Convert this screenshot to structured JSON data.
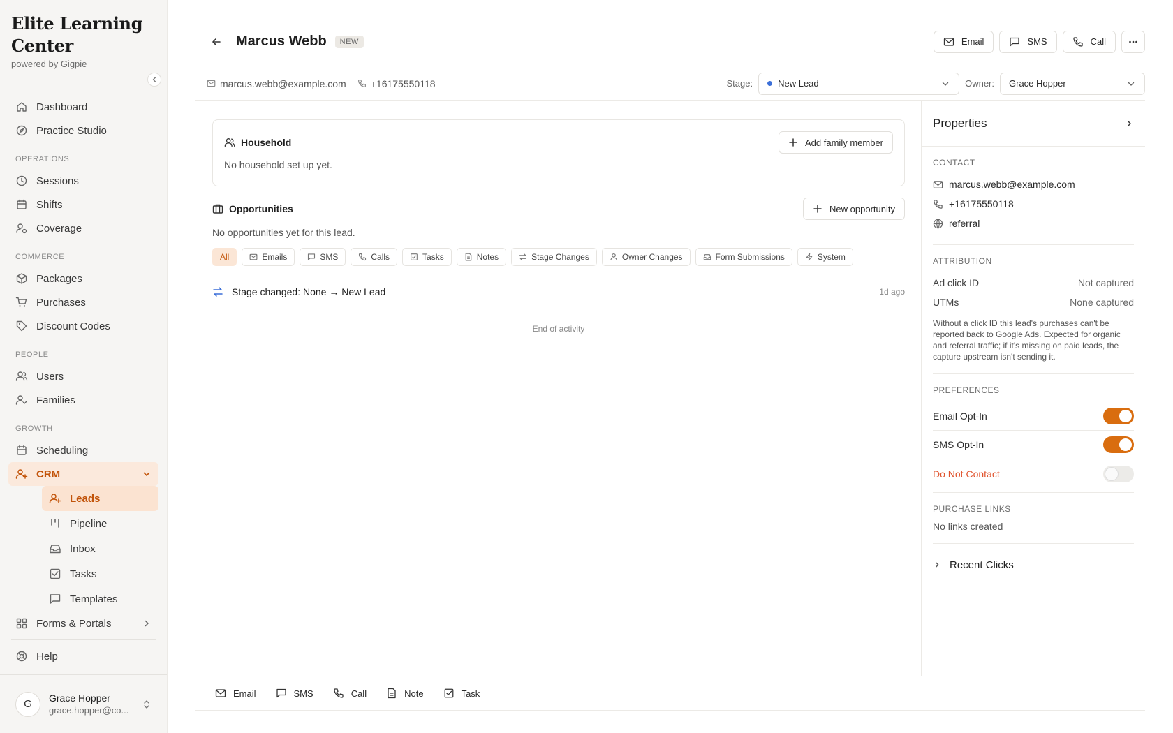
{
  "brand": {
    "title": "Elite Learning Center",
    "subtitle": "powered by Gigpie"
  },
  "nav": {
    "dashboard": "Dashboard",
    "practice_studio": "Practice Studio",
    "section_operations": "OPERATIONS",
    "sessions": "Sessions",
    "shifts": "Shifts",
    "coverage": "Coverage",
    "section_commerce": "COMMERCE",
    "packages": "Packages",
    "purchases": "Purchases",
    "discount_codes": "Discount Codes",
    "section_people": "PEOPLE",
    "users": "Users",
    "families": "Families",
    "section_growth": "GROWTH",
    "scheduling": "Scheduling",
    "crm": "CRM",
    "leads": "Leads",
    "pipeline": "Pipeline",
    "inbox": "Inbox",
    "tasks": "Tasks",
    "templates": "Templates",
    "forms_portals": "Forms & Portals",
    "help": "Help"
  },
  "user": {
    "initial": "G",
    "name": "Grace Hopper",
    "email": "grace.hopper@co..."
  },
  "lead": {
    "name": "Marcus Webb",
    "badge": "NEW",
    "email": "marcus.webb@example.com",
    "phone": "+16175550118"
  },
  "top_actions": {
    "email": "Email",
    "sms": "SMS",
    "call": "Call"
  },
  "stage": {
    "label": "Stage:",
    "value": "New Lead",
    "color": "#3b6fd8"
  },
  "owner": {
    "label": "Owner:",
    "value": "Grace Hopper"
  },
  "household": {
    "title": "Household",
    "add_button": "Add family member",
    "empty": "No household set up yet."
  },
  "opportunities": {
    "title": "Opportunities",
    "new_button": "New opportunity",
    "empty": "No opportunities yet for this lead."
  },
  "filters": [
    "All",
    "Emails",
    "SMS",
    "Calls",
    "Tasks",
    "Notes",
    "Stage Changes",
    "Owner Changes",
    "Form Submissions",
    "System"
  ],
  "activity": {
    "text": "Stage changed: None → New Lead",
    "time": "1d ago",
    "end": "End of activity"
  },
  "properties": {
    "title": "Properties",
    "contact_label": "CONTACT",
    "email": "marcus.webb@example.com",
    "phone": "+16175550118",
    "source": "referral",
    "attribution_label": "ATTRIBUTION",
    "ad_click_id_label": "Ad click ID",
    "ad_click_id_value": "Not captured",
    "utms_label": "UTMs",
    "utms_value": "None captured",
    "attribution_note": "Without a click ID this lead's purchases can't be reported back to Google Ads. Expected for organic and referral traffic; if it's missing on paid leads, the capture upstream isn't sending it.",
    "preferences_label": "PREFERENCES",
    "email_opt_in": "Email Opt-In",
    "sms_opt_in": "SMS Opt-In",
    "do_not_contact": "Do Not Contact",
    "purchase_links_label": "PURCHASE LINKS",
    "purchase_links_empty": "No links created",
    "recent_clicks": "Recent Clicks"
  },
  "composer": {
    "email": "Email",
    "sms": "SMS",
    "call": "Call",
    "note": "Note",
    "task": "Task"
  },
  "colors": {
    "accent": "#d96d0f",
    "accent_text": "#c2540a",
    "danger": "#e0522c"
  }
}
